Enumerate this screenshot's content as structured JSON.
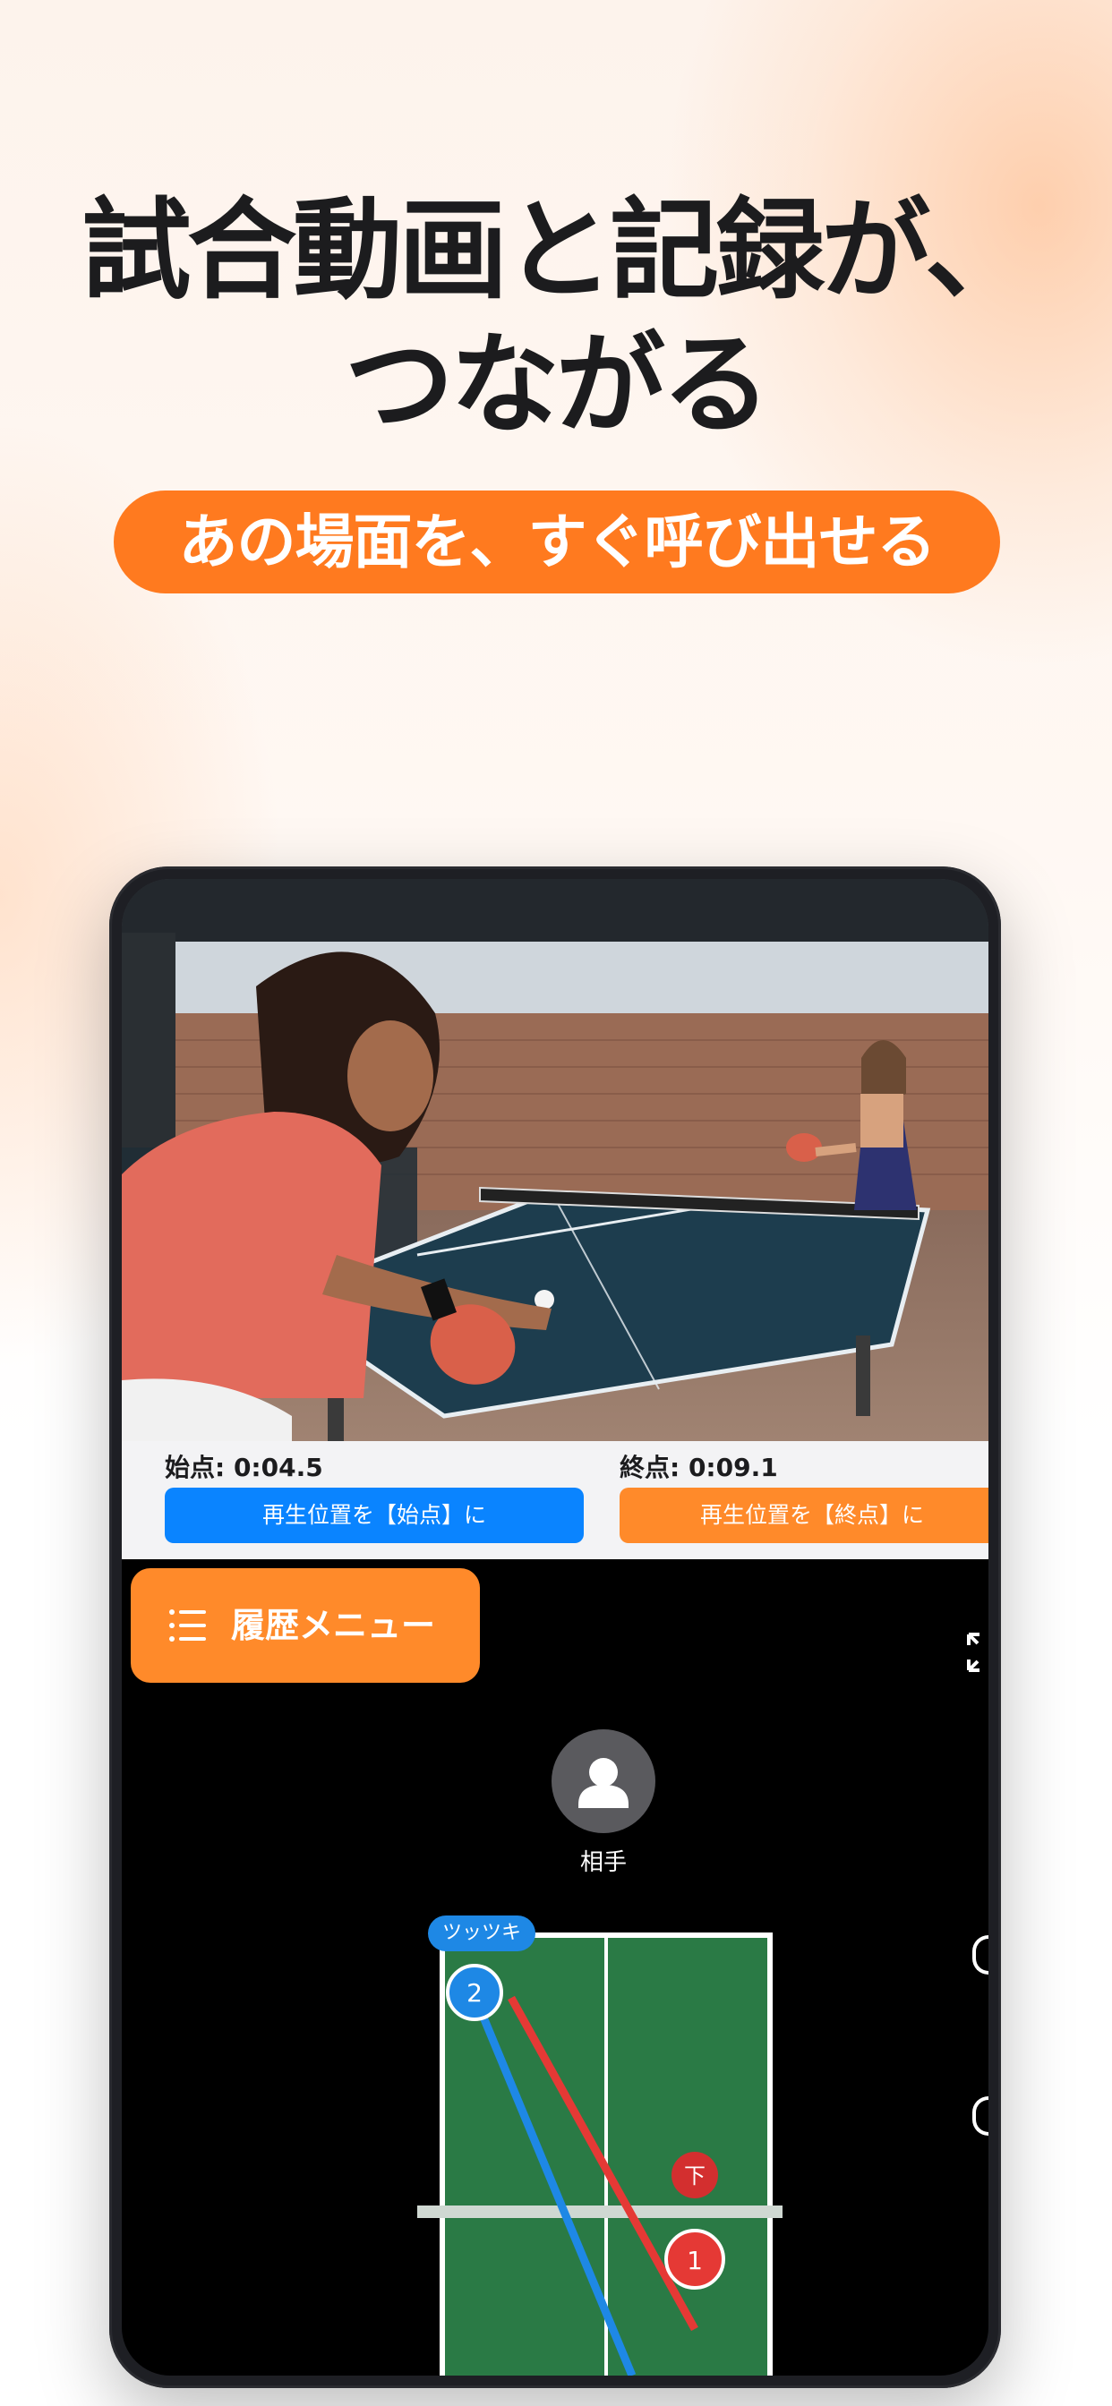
{
  "headline": {
    "line1": "試合動画と記録が、",
    "line2": "つながる"
  },
  "subheadline": "あの場面を、すぐ呼び出せる",
  "app": {
    "start_label": "始点: 0:04.5",
    "end_label": "終点: 0:09.1",
    "start_button": "再生位置を【始点】に",
    "end_button": "再生位置を【終点】に",
    "history_menu": "履歴メニュー",
    "opponent_label": "相手",
    "stroke_tag": "ツッツキ",
    "spin_badge": "下",
    "marker_1": "1",
    "marker_2": "2"
  },
  "colors": {
    "accent_orange": "#ff7a1f",
    "button_blue": "#0a84ff",
    "court_green": "#2a7a45",
    "trajectory_red": "#e53935",
    "trajectory_blue": "#1e88e5"
  },
  "icons": {
    "menu": "list-icon",
    "opponent": "person-icon",
    "fullscreen": "expand-icon"
  }
}
